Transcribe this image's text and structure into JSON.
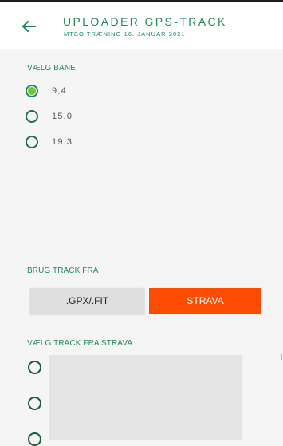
{
  "app_bar": {
    "title": "UPLOADER GPS-TRACK",
    "subtitle": "MTBO TRÆNING 16. JANUAR 2021",
    "back_icon": "arrow-left-icon"
  },
  "course_section": {
    "label": "VÆLG BANE",
    "options": [
      {
        "label": "9,4",
        "checked": true
      },
      {
        "label": "15,0",
        "checked": false
      },
      {
        "label": "19,3",
        "checked": false
      }
    ]
  },
  "track_source": {
    "label": "BRUG TRACK FRA",
    "gpx_button": ".GPX/.FIT",
    "strava_button": "STRAVA"
  },
  "strava_tracks": {
    "label": "VÆLG TRACK FRA STRAVA"
  },
  "colors": {
    "accent_green": "#1e8a58",
    "radio_selected": "#6ec63c",
    "strava_orange": "#fc4c02"
  }
}
